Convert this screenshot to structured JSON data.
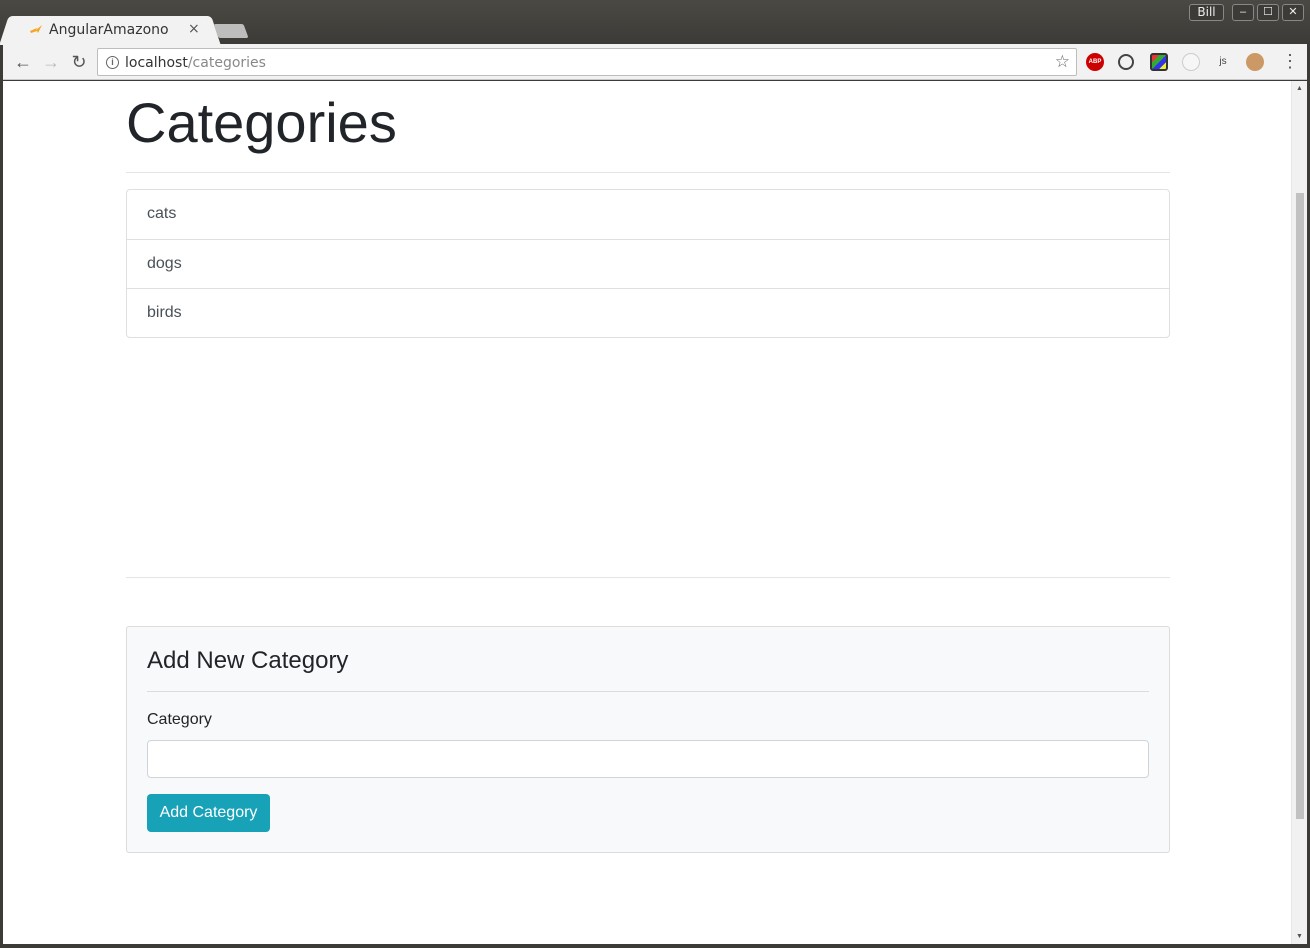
{
  "browser": {
    "tab_title": "AngularAmazono",
    "tab_close": "×",
    "user": "Bill",
    "url_host": "localhost",
    "url_path": "/categories",
    "extensions": [
      "adblock-plus-icon",
      "sync-icon",
      "colorzilla-icon",
      "react-devtools-icon",
      "nodejs-icon",
      "monkey-icon"
    ]
  },
  "page": {
    "title": "Categories",
    "categories": [
      "cats",
      "dogs",
      "birds"
    ],
    "form": {
      "heading": "Add New Category",
      "label": "Category",
      "value": "",
      "placeholder": "",
      "button": "Add Category"
    }
  },
  "colors": {
    "accent": "#17a2b8",
    "text": "#212529"
  }
}
